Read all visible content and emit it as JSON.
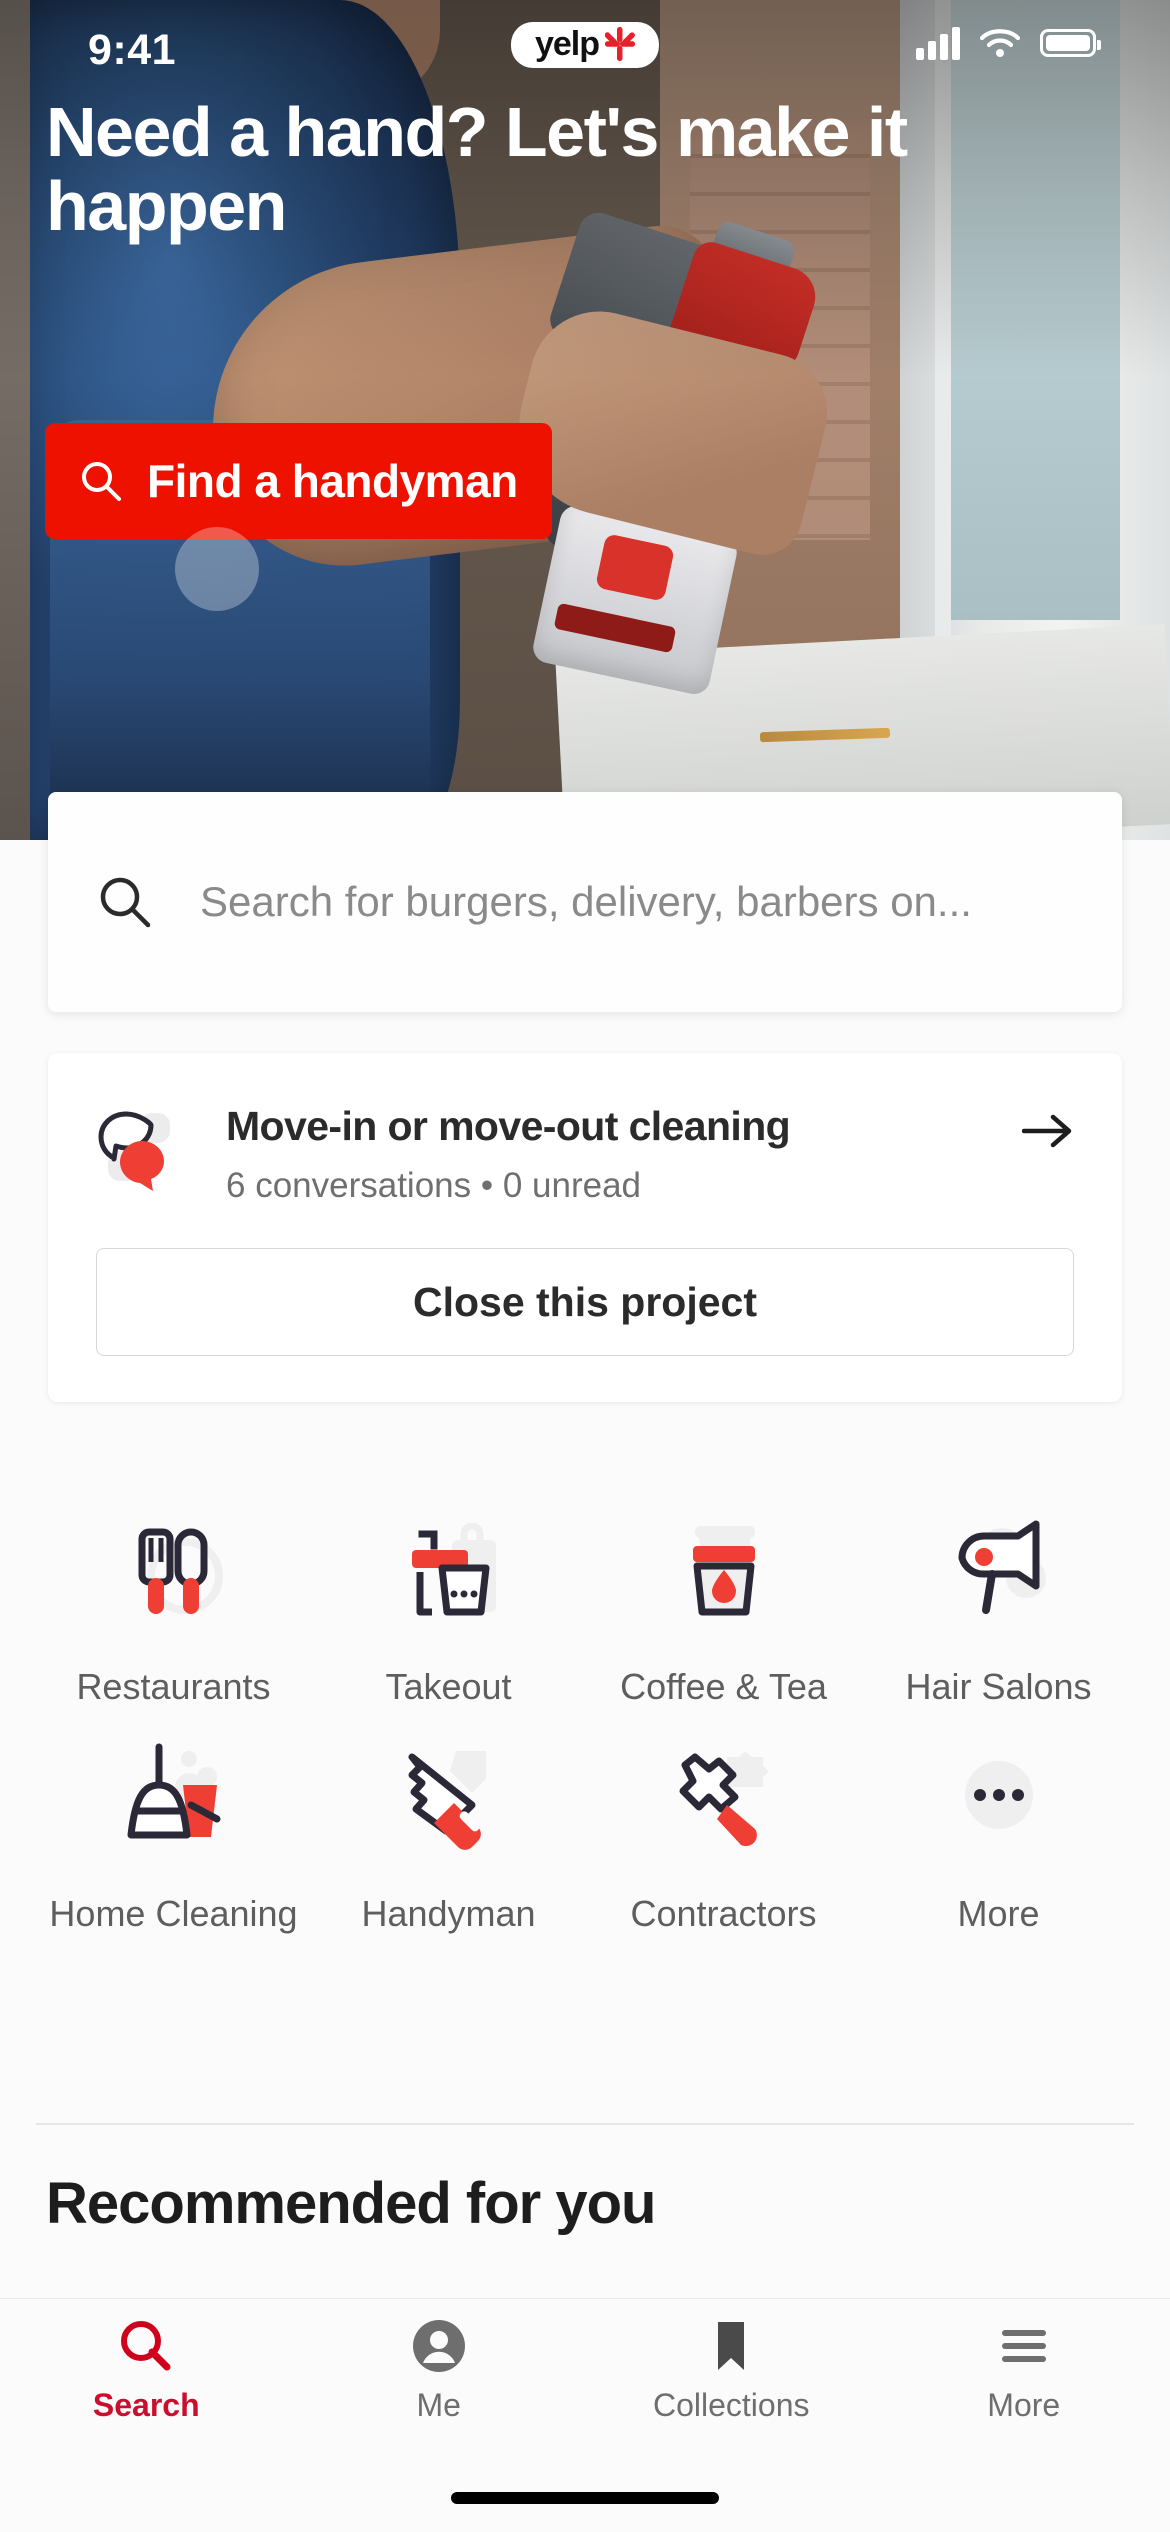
{
  "status_bar": {
    "time": "9:41",
    "brand_logo_text": "yelp",
    "icons": [
      "cellular-signal-icon",
      "wifi-icon",
      "battery-icon"
    ]
  },
  "hero": {
    "headline": "Need a hand? Let's make it happen",
    "cta_label": "Find a handyman",
    "cta_icon": "search-icon",
    "cta_color": "#ee1100"
  },
  "search": {
    "icon": "search-icon",
    "placeholder": "Search for burgers, delivery, barbers on...",
    "value": ""
  },
  "project_card": {
    "icon": "chat-bubbles-icon",
    "title": "Move-in or move-out cleaning",
    "subtitle": "6 conversations • 0 unread",
    "arrow_icon": "arrow-right-icon",
    "close_label": "Close this project"
  },
  "categories": [
    {
      "label": "Restaurants",
      "icon": "utensils-icon"
    },
    {
      "label": "Takeout",
      "icon": "takeout-bag-icon"
    },
    {
      "label": "Coffee & Tea",
      "icon": "coffee-cup-icon"
    },
    {
      "label": "Hair Salons",
      "icon": "hair-dryer-icon"
    },
    {
      "label": "Home Cleaning",
      "icon": "broom-bucket-icon"
    },
    {
      "label": "Handyman",
      "icon": "handsaw-icon"
    },
    {
      "label": "Contractors",
      "icon": "hammer-icon"
    },
    {
      "label": "More",
      "icon": "ellipsis-icon"
    }
  ],
  "sections": {
    "recommended_title": "Recommended for you"
  },
  "tab_bar": {
    "active_color": "#c8102e",
    "inactive_color": "#6e6e6e",
    "items": [
      {
        "label": "Search",
        "icon": "search-icon",
        "active": true
      },
      {
        "label": "Me",
        "icon": "person-circle-icon",
        "active": false
      },
      {
        "label": "Collections",
        "icon": "bookmark-icon",
        "active": false
      },
      {
        "label": "More",
        "icon": "hamburger-menu-icon",
        "active": false
      }
    ]
  },
  "colors": {
    "brand_red": "#ee1100",
    "icon_dark": "#2b2838",
    "icon_red": "#ef3e33",
    "icon_gray": "#ebebeb"
  }
}
